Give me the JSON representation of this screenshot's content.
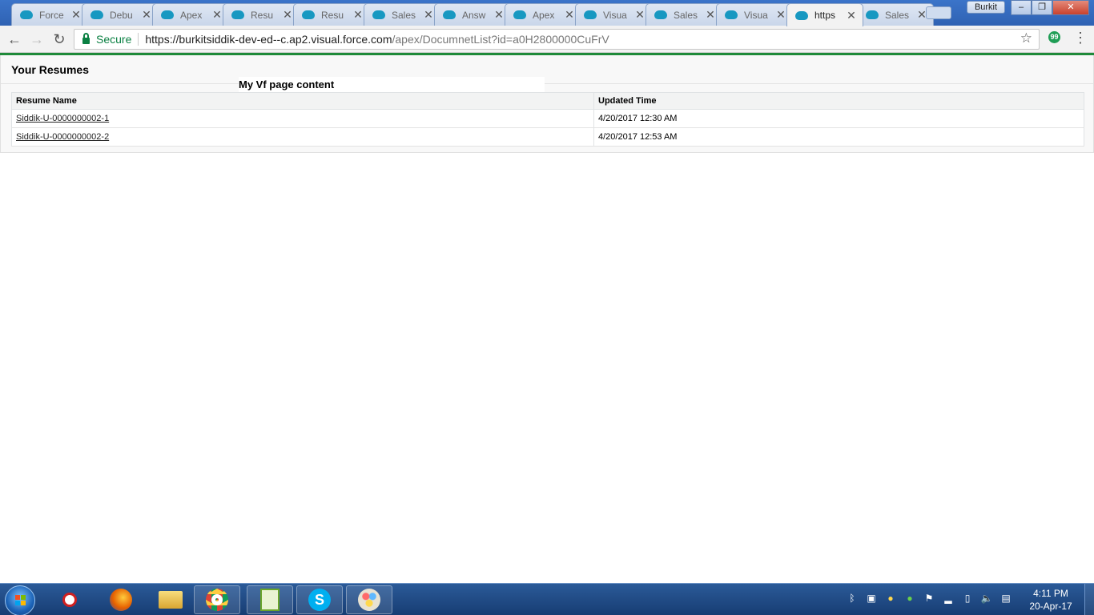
{
  "browser": {
    "tabs": [
      {
        "title": "Force"
      },
      {
        "title": "Debu"
      },
      {
        "title": "Apex"
      },
      {
        "title": "Resu"
      },
      {
        "title": "Resu"
      },
      {
        "title": "Sales"
      },
      {
        "title": "Answ"
      },
      {
        "title": "Apex"
      },
      {
        "title": "Visua"
      },
      {
        "title": "Sales"
      },
      {
        "title": "Visua"
      },
      {
        "title": "https"
      },
      {
        "title": "Sales"
      }
    ],
    "active_tab_index": 11,
    "user_name": "Burkit",
    "secure_label": "Secure",
    "url_host": "https://burkitsiddik-dev-ed--c.ap2.visual.force.com",
    "url_path": "/apex/DocumnetList?id=a0H2800000CuFrV",
    "extension_glyph": "99",
    "accent_color": "#1f8a3a"
  },
  "page": {
    "title": "Your Resumes",
    "overlay_text": "My Vf page content",
    "table": {
      "headers": [
        "Resume Name",
        "Updated Time"
      ],
      "rows": [
        {
          "name": "Siddik-U-0000000002-1",
          "updated": "4/20/2017 12:30 AM"
        },
        {
          "name": "Siddik-U-0000000002-2",
          "updated": "4/20/2017 12:53 AM"
        }
      ]
    }
  },
  "taskbar": {
    "clock_time": "4:11 PM",
    "clock_date": "20-Apr-17"
  }
}
